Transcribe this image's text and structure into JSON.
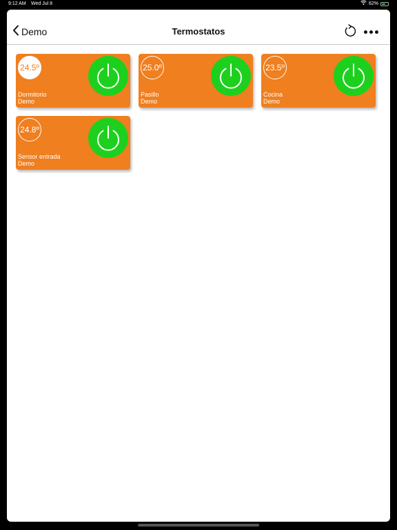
{
  "status_bar": {
    "time": "9:12 AM",
    "date": "Wed Jul 8",
    "battery": "62%",
    "battery_level": 0.62,
    "wifi_icon": "wifi-icon",
    "battery_icon": "battery-charging-icon"
  },
  "header": {
    "back_label": "Demo",
    "title": "Termostatos",
    "refresh_icon": "refresh-icon",
    "more_icon": "more-icon"
  },
  "thermostats": [
    {
      "temp": "24.5º",
      "name": "Dormitorio",
      "group": "Demo",
      "selected": true,
      "power": "on"
    },
    {
      "temp": "25.0º",
      "name": "Pasillo",
      "group": "Demo",
      "selected": false,
      "power": "on"
    },
    {
      "temp": "23.5º",
      "name": "Cocina",
      "group": "Demo",
      "selected": false,
      "power": "on"
    },
    {
      "temp": "24.8º",
      "name": "Sensor entrada",
      "group": "Demo",
      "selected": false,
      "power": "on"
    }
  ],
  "colors": {
    "tile": "#ef7f1f",
    "power_on": "#1ed01e",
    "text": "#111111"
  }
}
